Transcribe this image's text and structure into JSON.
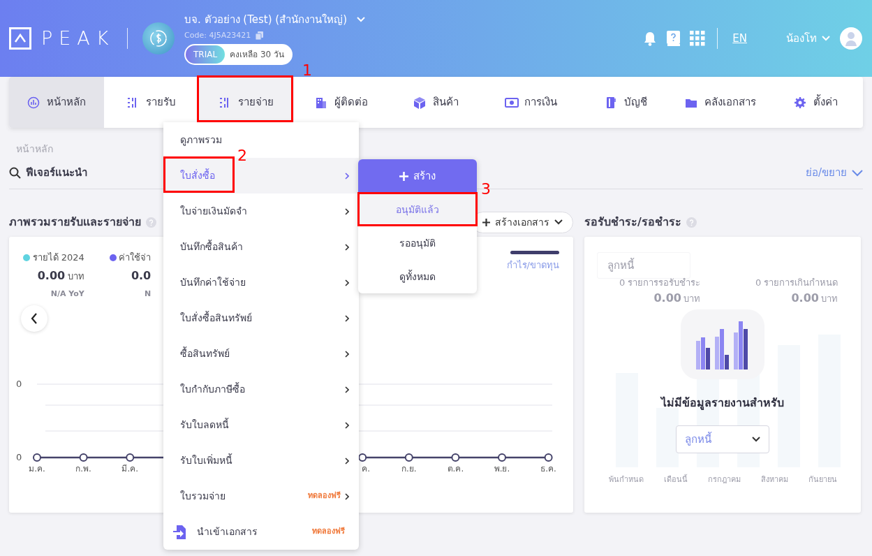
{
  "header": {
    "logo": "PEAK",
    "company": {
      "name": "บจ. ตัวอย่าง (Test) (สำนักงานใหญ่)",
      "code": "Code: 4J5A23421",
      "trial_badge": "TRIAL",
      "trial_text": "คงเหลือ 30 วัน"
    },
    "language": "EN",
    "user": "น้องโท"
  },
  "nav": [
    {
      "label": "หน้าหลัก",
      "selected": true,
      "expanded": false
    },
    {
      "label": "รายรับ",
      "selected": false,
      "expanded": false
    },
    {
      "label": "รายจ่าย",
      "selected": false,
      "expanded": true
    },
    {
      "label": "ผู้ติดต่อ",
      "selected": false,
      "expanded": false
    },
    {
      "label": "สินค้า",
      "selected": false,
      "expanded": false
    },
    {
      "label": "การเงิน",
      "selected": false,
      "expanded": false
    },
    {
      "label": "บัญชี",
      "selected": false,
      "expanded": false
    },
    {
      "label": "คลังเอกสาร",
      "selected": false,
      "expanded": false
    },
    {
      "label": "ตั้งค่า",
      "selected": false,
      "expanded": false
    }
  ],
  "breadcrumb": "หน้าหลัก",
  "features": {
    "title": "ฟีเจอร์แนะนำ",
    "toggle": "ย่อ/ขยาย"
  },
  "overview": {
    "title": "ภาพรวมรายรับและรายจ่าย",
    "create_button": "สร้างเอกสาร",
    "legend": [
      {
        "label": "รายได้ 2024",
        "color": "#5fd3e0",
        "amount": "0.00",
        "unit": "บาท",
        "yoy": "N/A YoY"
      },
      {
        "label": "ค่าใช้จ่า",
        "color": "#6c63f0",
        "amount": "0.0",
        "yoy": "N"
      }
    ],
    "profit_legend": "กำไร/ขาดทุน",
    "y_labels": [
      "0",
      "0"
    ],
    "x_labels_start": [
      "ม.ค.",
      "ก.พ.",
      "มี.ค."
    ],
    "x_labels_end": [
      "ค.",
      "ก.ย.",
      "ต.ค.",
      "พ.ย.",
      "ธ.ค."
    ]
  },
  "receivables": {
    "title": "รอรับชำระ/รอชำระ",
    "faded": {
      "select": "ลูกหนี้",
      "stats": [
        {
          "label": "0 รายการรอรับชำระ",
          "amount": "0.00",
          "unit": "บาท"
        },
        {
          "label": "0 รายการเกินกำหนด",
          "amount": "0.00",
          "unit": "บาท"
        }
      ],
      "months": [
        "พ้นกำหนด",
        "เดือนนี้",
        "กรกฎาคม",
        "สิงหาคม",
        "กันยายน"
      ]
    },
    "empty_text": "ไม่มีข้อมูลรายงานสำหรับ",
    "select": "ลูกหนี้"
  },
  "menu": [
    {
      "kind": "link",
      "label": "ดูภาพรวม",
      "selected": false,
      "submenu": false
    },
    {
      "kind": "link",
      "label": "ใบสั่งซื้อ",
      "selected": true,
      "submenu": true
    },
    {
      "kind": "link",
      "label": "ใบจ่ายเงินมัดจำ",
      "selected": false,
      "submenu": true
    },
    {
      "kind": "link",
      "label": "บันทึกซื้อสินค้า",
      "selected": false,
      "submenu": true
    },
    {
      "kind": "link",
      "label": "บันทึกค่าใช้จ่าย",
      "selected": false,
      "submenu": true
    },
    {
      "kind": "link",
      "label": "ใบสั่งซื้อสินทรัพย์",
      "selected": false,
      "submenu": true
    },
    {
      "kind": "link",
      "label": "ซื้อสินทรัพย์",
      "selected": false,
      "submenu": true
    },
    {
      "kind": "link",
      "label": "ใบกำกับภาษีซื้อ",
      "selected": false,
      "submenu": true
    },
    {
      "kind": "link",
      "label": "รับใบลดหนี้",
      "selected": false,
      "submenu": true
    },
    {
      "kind": "link",
      "label": "รับใบเพิ่มหนี้",
      "selected": false,
      "submenu": true
    },
    {
      "kind": "link",
      "label": "ใบรวมจ่าย",
      "selected": false,
      "submenu": true,
      "badge": "ทดลองฟรี"
    },
    {
      "kind": "import",
      "label": "นำเข้าเอกสาร",
      "selected": false,
      "submenu": false,
      "badge": "ทดลองฟรี"
    }
  ],
  "submenu": {
    "create": "สร้าง",
    "items": [
      {
        "label": "อนุมัติแล้ว",
        "selected": true
      },
      {
        "label": "รออนุมัติ",
        "selected": false
      },
      {
        "label": "ดูทั้งหมด",
        "selected": false
      }
    ]
  },
  "annotations": [
    {
      "number": "1"
    },
    {
      "number": "2"
    },
    {
      "number": "3"
    }
  ]
}
